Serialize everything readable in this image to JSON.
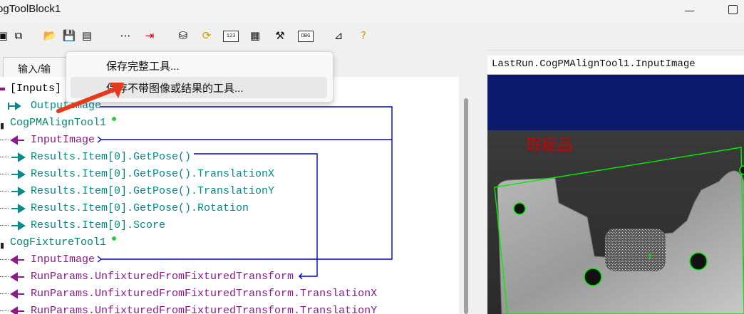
{
  "window": {
    "title": "ogToolBlock1"
  },
  "toolbar": {
    "icons": [
      "window-icon",
      "window-copy-icon",
      "open-folder-icon",
      "save-icon",
      "save-as-icon",
      "dotted-line-icon",
      "import-icon",
      "database-icon",
      "run-icon",
      "terminal-123-icon",
      "form-icon",
      "tools-icon",
      "dbg-icon",
      "chart-icon",
      "help-icon"
    ],
    "text_123": "123",
    "text_dbg": "DBG"
  },
  "left_tab": {
    "label": "输入/输"
  },
  "context_menu": {
    "items": [
      {
        "label": "保存完整工具..."
      },
      {
        "label": "保存不带图像或结果的工具..."
      }
    ],
    "highlighted_index": 1
  },
  "tree": {
    "rows": [
      {
        "label": "[Inputs]",
        "color": "#222222"
      },
      {
        "label": "OutputImage",
        "color": "#008b8b"
      },
      {
        "label": "CogPMAlignTool1",
        "color": "#00876b"
      },
      {
        "label": "InputImage",
        "color": "#8b1a8b"
      },
      {
        "label": "Results.Item[0].GetPose()",
        "color": "#008b8b"
      },
      {
        "label": "Results.Item[0].GetPose().TranslationX",
        "color": "#008b8b"
      },
      {
        "label": "Results.Item[0].GetPose().TranslationY",
        "color": "#008b8b"
      },
      {
        "label": "Results.Item[0].GetPose().Rotation",
        "color": "#008b8b"
      },
      {
        "label": "Results.Item[0].Score",
        "color": "#008b8b"
      },
      {
        "label": "CogFixtureTool1",
        "color": "#00876b"
      },
      {
        "label": "InputImage",
        "color": "#8b1a8b"
      },
      {
        "label": "RunParams.UnfixturedFromFixturedTransform",
        "color": "#8b1a8b"
      },
      {
        "label": "RunParams.UnfixturedFromFixturedTransform.TranslationX",
        "color": "#8b1a8b"
      },
      {
        "label": "RunParams.UnfixturedFromFixturedTransform.TranslationY",
        "color": "#8b1a8b"
      }
    ],
    "link_color": "#0000cc"
  },
  "right_panel": {
    "title": "LastRun.CogPMAlignTool1.InputImage",
    "image_caption": "瑕疵品",
    "caption_color": "#cc0000",
    "band_color": "#0c1a6e",
    "overlay_color": "#00ff00"
  }
}
